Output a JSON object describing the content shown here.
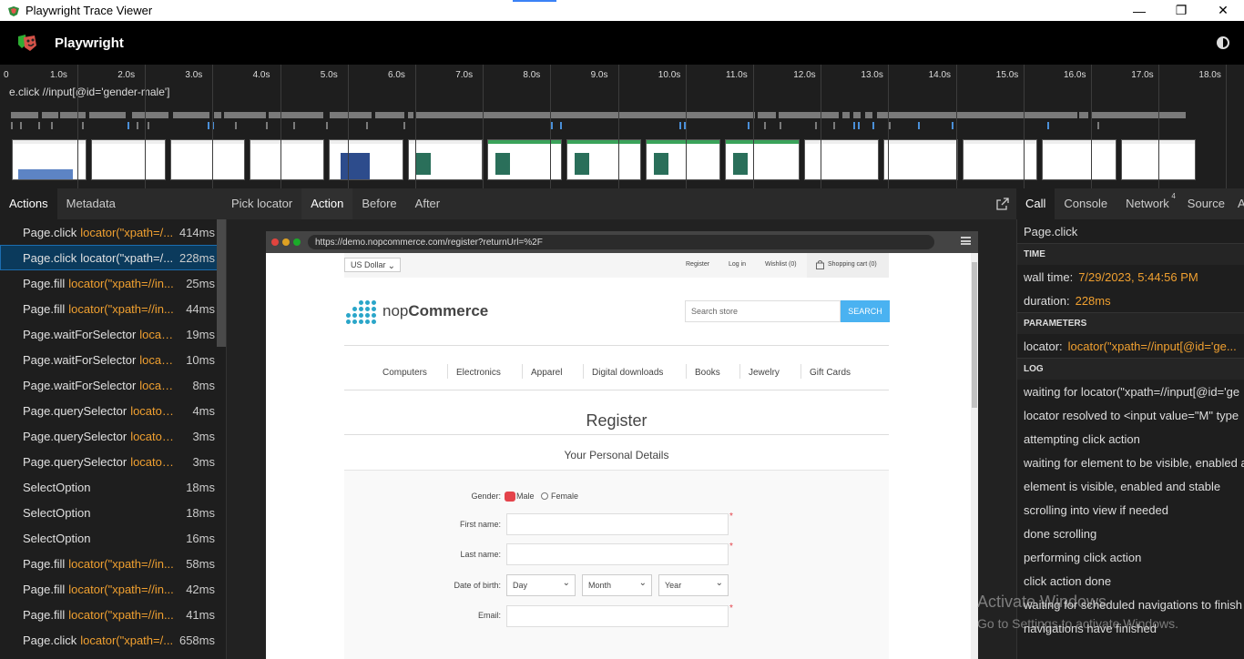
{
  "window": {
    "title": "Playwright Trace Viewer",
    "minimize": "—",
    "restore": "❐",
    "close": "✕"
  },
  "header": {
    "brand": "Playwright"
  },
  "timeline": {
    "labels": [
      "0",
      "1.0s",
      "2.0s",
      "3.0s",
      "4.0s",
      "5.0s",
      "6.0s",
      "7.0s",
      "8.0s",
      "9.0s",
      "10.0s",
      "11.0s",
      "12.0s",
      "13.0s",
      "14.0s",
      "15.0s",
      "16.0s",
      "17.0s",
      "18.0s"
    ],
    "hover_action": "e.click //input[@id='gender-male']"
  },
  "left_tabs": [
    "Actions",
    "Metadata"
  ],
  "actions": [
    {
      "name": "Page.click",
      "locator": "locator(\"xpath=/...",
      "time": "414ms"
    },
    {
      "name": "Page.click",
      "locator": "locator(\"xpath=/...",
      "time": "228ms",
      "selected": true
    },
    {
      "name": "Page.fill",
      "locator": "locator(\"xpath=//in...",
      "time": "25ms"
    },
    {
      "name": "Page.fill",
      "locator": "locator(\"xpath=//in...",
      "time": "44ms"
    },
    {
      "name": "Page.waitForSelector",
      "locator": "locator...",
      "time": "19ms"
    },
    {
      "name": "Page.waitForSelector",
      "locator": "locator...",
      "time": "10ms"
    },
    {
      "name": "Page.waitForSelector",
      "locator": "locator(...",
      "time": "8ms"
    },
    {
      "name": "Page.querySelector",
      "locator": "locator(\"x...",
      "time": "4ms"
    },
    {
      "name": "Page.querySelector",
      "locator": "locator(\"x...",
      "time": "3ms"
    },
    {
      "name": "Page.querySelector",
      "locator": "locator(\"x...",
      "time": "3ms"
    },
    {
      "name": "SelectOption",
      "locator": "",
      "time": "18ms"
    },
    {
      "name": "SelectOption",
      "locator": "",
      "time": "18ms"
    },
    {
      "name": "SelectOption",
      "locator": "",
      "time": "16ms"
    },
    {
      "name": "Page.fill",
      "locator": "locator(\"xpath=//in...",
      "time": "58ms"
    },
    {
      "name": "Page.fill",
      "locator": "locator(\"xpath=//in...",
      "time": "42ms"
    },
    {
      "name": "Page.fill",
      "locator": "locator(\"xpath=//in...",
      "time": "41ms"
    },
    {
      "name": "Page.click",
      "locator": "locator(\"xpath=/...",
      "time": "658ms"
    }
  ],
  "center_tabs": {
    "pick": "Pick locator",
    "action": "Action",
    "before": "Before",
    "after": "After"
  },
  "browser": {
    "url": "https://demo.nopcommerce.com/register?returnUrl=%2F"
  },
  "site": {
    "currency": "US Dollar",
    "links": {
      "register": "Register",
      "login": "Log in",
      "wishlist": "Wishlist (0)",
      "cart": "Shopping cart (0)"
    },
    "brand_a": "nop",
    "brand_b": "Commerce",
    "search_placeholder": "Search store",
    "search_btn": "SEARCH",
    "nav": [
      "Computers",
      "Electronics",
      "Apparel",
      "Digital downloads",
      "Books",
      "Jewelry",
      "Gift Cards"
    ],
    "page_title": "Register",
    "section": "Your Personal Details",
    "gender_label": "Gender:",
    "male": "Male",
    "female": "Female",
    "first_name": "First name:",
    "last_name": "Last name:",
    "dob": "Date of birth:",
    "day": "Day",
    "month": "Month",
    "year": "Year",
    "email": "Email:",
    "req": "*"
  },
  "right_tabs": {
    "call": "Call",
    "console": "Console",
    "network": "Network",
    "network_badge": "4",
    "source": "Source",
    "more": "A"
  },
  "call": {
    "method": "Page.click",
    "time_head": "TIME",
    "wall_key": "wall time:",
    "wall_val": "7/29/2023, 5:44:56 PM",
    "dur_key": "duration:",
    "dur_val": "228ms",
    "params_head": "PARAMETERS",
    "loc_key": "locator:",
    "loc_val": "locator(\"xpath=//input[@id='ge...",
    "log_head": "LOG",
    "log": [
      "waiting for locator(\"xpath=//input[@id='ge",
      "locator resolved to <input value=\"M\" type",
      "attempting click action",
      "waiting for element to be visible, enabled a",
      "element is visible, enabled and stable",
      "scrolling into view if needed",
      "done scrolling",
      "performing click action",
      "click action done",
      "waiting for scheduled navigations to finish",
      "navigations have finished"
    ]
  },
  "watermark": {
    "line1": "Activate Windows",
    "line2": "Go to Settings to activate Windows."
  },
  "colors": {
    "accent": "#f0a030",
    "selected_bg": "#0b3a5c",
    "search_btn": "#4ab2f1",
    "logo_dots": "#2aa6c9"
  }
}
